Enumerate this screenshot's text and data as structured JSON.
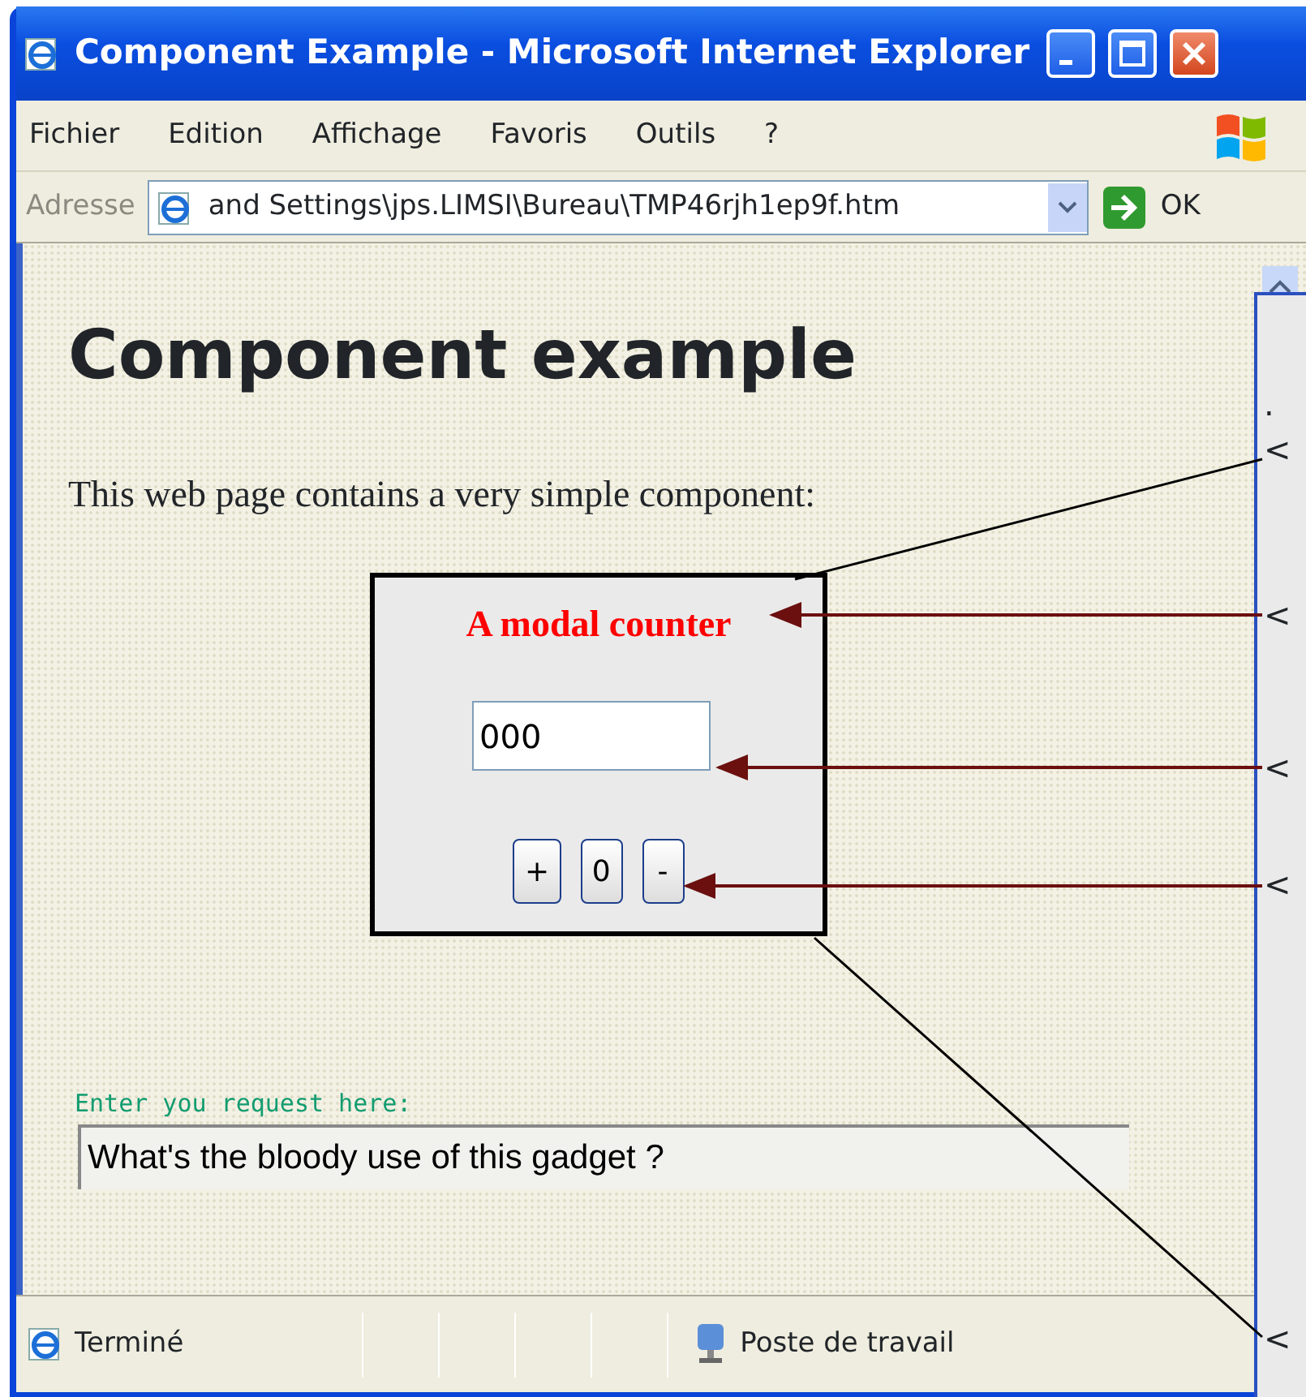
{
  "window": {
    "title": "Component Example - Microsoft Internet Explorer"
  },
  "menu": [
    "Fichier",
    "Edition",
    "Affichage",
    "Favoris",
    "Outils",
    "?"
  ],
  "address_bar": {
    "label": "Adresse",
    "value": "and Settings\\jps.LIMSI\\Bureau\\TMP46rjh1ep9f.htm",
    "go": "OK"
  },
  "page": {
    "heading": "Component example",
    "intro": "This web page contains a very simple component:",
    "component": {
      "title": "A modal counter",
      "value": "000",
      "buttons": [
        "+",
        "0",
        "-"
      ]
    },
    "request": {
      "label": "Enter you request here:",
      "value": "What's the bloody use of this gadget ?"
    }
  },
  "status_bar": {
    "status": "Terminé",
    "zone": "Poste de travail"
  },
  "annotation_panel": {
    "dot": ".",
    "markers": [
      "<",
      "<",
      "<",
      "<",
      "<"
    ]
  }
}
